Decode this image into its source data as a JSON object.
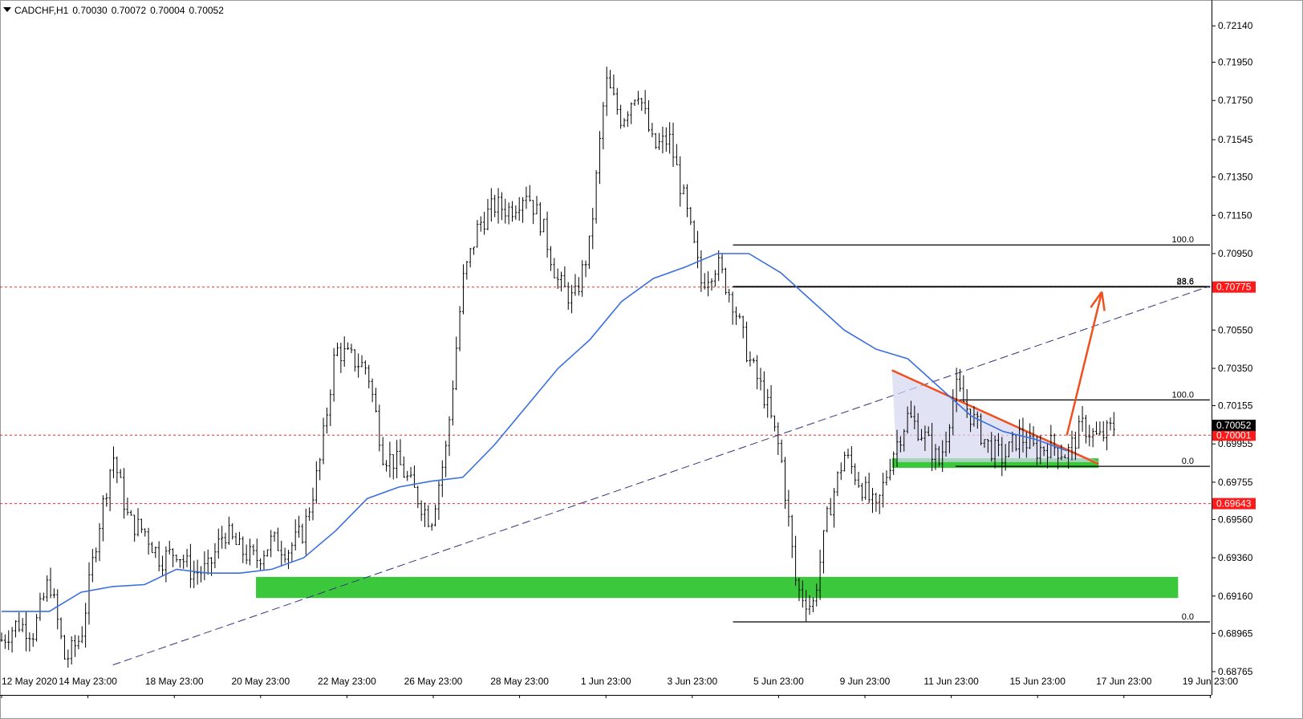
{
  "header": {
    "symbol": "CADCHF,H1",
    "open": "0.70030",
    "high": "0.70072",
    "low": "0.70004",
    "close": "0.70052"
  },
  "colors": {
    "candle": "#000000",
    "ma": "#3a6fe0",
    "trend_dash": "#33337a",
    "support": "#3cc83c",
    "hline": "#e03030",
    "wedge_line": "#f0501e",
    "wedge_fill": "#d4d7f0",
    "fib": "#000000",
    "tag_red": "#ff1a1a",
    "tag_black": "#000000"
  },
  "chart_data": {
    "type": "candlestick",
    "title": "CADCHF,H1",
    "ylim": [
      0.6866,
      0.7225
    ],
    "y_ticks": [
      "0.72140",
      "0.71950",
      "0.71750",
      "0.71545",
      "0.71350",
      "0.71150",
      "0.70950",
      "0.70550",
      "0.70350",
      "0.70155",
      "0.69955",
      "0.69755",
      "0.69560",
      "0.69360",
      "0.69160",
      "0.68965",
      "0.68765"
    ],
    "x_ticks": [
      "12 May 2020",
      "14 May 23:00",
      "18 May 23:00",
      "20 May 23:00",
      "22 May 23:00",
      "26 May 23:00",
      "28 May 23:00",
      "1 Jun 23:00",
      "3 Jun 23:00",
      "5 Jun 23:00",
      "9 Jun 23:00",
      "11 Jun 23:00",
      "15 Jun 23:00",
      "17 Jun 23:00",
      "19 Jun 23:00"
    ],
    "x_range": [
      0,
      30
    ],
    "path": [
      [
        0,
        0.6893
      ],
      [
        1,
        0.6902
      ],
      [
        2,
        0.6897
      ],
      [
        3,
        0.6925
      ],
      [
        4,
        0.6882
      ],
      [
        5,
        0.6895
      ],
      [
        6,
        0.6948
      ],
      [
        7,
        0.699
      ],
      [
        8,
        0.6955
      ],
      [
        9,
        0.695
      ],
      [
        10,
        0.6935
      ],
      [
        11,
        0.694
      ],
      [
        12,
        0.6928
      ],
      [
        13,
        0.693
      ],
      [
        14,
        0.695
      ],
      [
        15,
        0.694
      ],
      [
        16,
        0.6935
      ],
      [
        17,
        0.6945
      ],
      [
        18,
        0.694
      ],
      [
        19,
        0.695
      ],
      [
        20,
        0.6985
      ],
      [
        21,
        0.7045
      ],
      [
        22,
        0.704
      ],
      [
        23,
        0.7035
      ],
      [
        24,
        0.699
      ],
      [
        25,
        0.6985
      ],
      [
        26,
        0.697
      ],
      [
        27,
        0.6955
      ],
      [
        28,
        0.6995
      ],
      [
        29,
        0.708
      ],
      [
        30,
        0.711
      ],
      [
        31,
        0.712
      ],
      [
        32,
        0.7118
      ],
      [
        33,
        0.7128
      ],
      [
        34,
        0.711
      ],
      [
        35,
        0.708
      ],
      [
        36,
        0.707
      ],
      [
        37,
        0.71
      ],
      [
        38,
        0.7185
      ],
      [
        39,
        0.7165
      ],
      [
        40,
        0.7182
      ],
      [
        41,
        0.715
      ],
      [
        42,
        0.7155
      ],
      [
        43,
        0.712
      ],
      [
        44,
        0.708
      ],
      [
        45,
        0.709
      ],
      [
        46,
        0.707
      ],
      [
        47,
        0.704
      ],
      [
        48,
        0.702
      ],
      [
        49,
        0.699
      ],
      [
        50,
        0.692
      ],
      [
        51,
        0.691
      ],
      [
        52,
        0.696
      ],
      [
        53,
        0.699
      ],
      [
        54,
        0.6975
      ],
      [
        55,
        0.696
      ],
      [
        56,
        0.699
      ],
      [
        57,
        0.701
      ],
      [
        58,
        0.7
      ],
      [
        59,
        0.6985
      ],
      [
        60,
        0.7025
      ],
      [
        61,
        0.701
      ],
      [
        62,
        0.6995
      ],
      [
        63,
        0.6988
      ],
      [
        64,
        0.7
      ],
      [
        65,
        0.6992
      ],
      [
        66,
        0.6995
      ],
      [
        67,
        0.699
      ],
      [
        68,
        0.7005
      ],
      [
        69,
        0.6998
      ],
      [
        70,
        0.7005
      ]
    ],
    "series": [
      {
        "name": "",
        "kind": "moving-average",
        "points": [
          [
            0,
            0.6908
          ],
          [
            3,
            0.6908
          ],
          [
            5,
            0.6918
          ],
          [
            7,
            0.6921
          ],
          [
            9,
            0.6922
          ],
          [
            11,
            0.693
          ],
          [
            13,
            0.6928
          ],
          [
            15,
            0.6928
          ],
          [
            17,
            0.693
          ],
          [
            19,
            0.6936
          ],
          [
            21,
            0.695
          ],
          [
            23,
            0.6967
          ],
          [
            25,
            0.6973
          ],
          [
            27,
            0.6976
          ],
          [
            29,
            0.6978
          ],
          [
            31,
            0.6995
          ],
          [
            33,
            0.7015
          ],
          [
            35,
            0.7035
          ],
          [
            37,
            0.705
          ],
          [
            39,
            0.707
          ],
          [
            41,
            0.7082
          ],
          [
            43,
            0.7088
          ],
          [
            45,
            0.7095
          ],
          [
            47,
            0.7095
          ],
          [
            49,
            0.7085
          ],
          [
            51,
            0.707
          ],
          [
            53,
            0.7055
          ],
          [
            55,
            0.7045
          ],
          [
            57,
            0.704
          ],
          [
            59,
            0.7025
          ],
          [
            61,
            0.701
          ],
          [
            63,
            0.7002
          ],
          [
            65,
            0.6998
          ],
          [
            67,
            0.6992
          ]
        ]
      }
    ],
    "trend_line": [
      [
        7,
        0.688
      ],
      [
        76,
        0.7078
      ]
    ],
    "support_zones": [
      {
        "x0": 16,
        "x1": 74,
        "y0": 0.6915,
        "y1": 0.6926
      },
      {
        "x0": 56,
        "x1": 69,
        "y0": 0.6983,
        "y1": 0.6988
      }
    ],
    "horizontal_levels": [
      {
        "value": 0.70775,
        "label": "0.70775",
        "tag": "red"
      },
      {
        "value": 0.70001,
        "label": "0.70001",
        "tag": "red"
      },
      {
        "value": 0.69643,
        "label": "0.69643",
        "tag": "red"
      }
    ],
    "last_price": {
      "value": 0.70052,
      "label": "0.70052"
    },
    "wedge": {
      "points": [
        [
          56,
          0.7034
        ],
        [
          56.3,
          0.6986
        ],
        [
          69,
          0.6986
        ]
      ],
      "upper_line": [
        [
          56,
          0.7034
        ],
        [
          69,
          0.6985
        ]
      ]
    },
    "target_arrow": [
      [
        67,
        0.7
      ],
      [
        69.2,
        0.7075
      ]
    ],
    "fib_sets": [
      {
        "x0": 46,
        "x1": 74,
        "levels": [
          {
            "value": 0.70995,
            "label": "100.0"
          },
          {
            "value": 0.69025,
            "label": "0.0"
          }
        ]
      },
      {
        "x0": 46,
        "x1": 74,
        "levels": [
          {
            "value": 0.70775,
            "label": "23.6"
          },
          {
            "value": 0.70778,
            "label": "88.6"
          }
        ]
      },
      {
        "x0": 60,
        "x1": 74,
        "levels": [
          {
            "value": 0.70185,
            "label": "100.0"
          },
          {
            "value": 0.69838,
            "label": "0.0"
          }
        ]
      }
    ]
  }
}
